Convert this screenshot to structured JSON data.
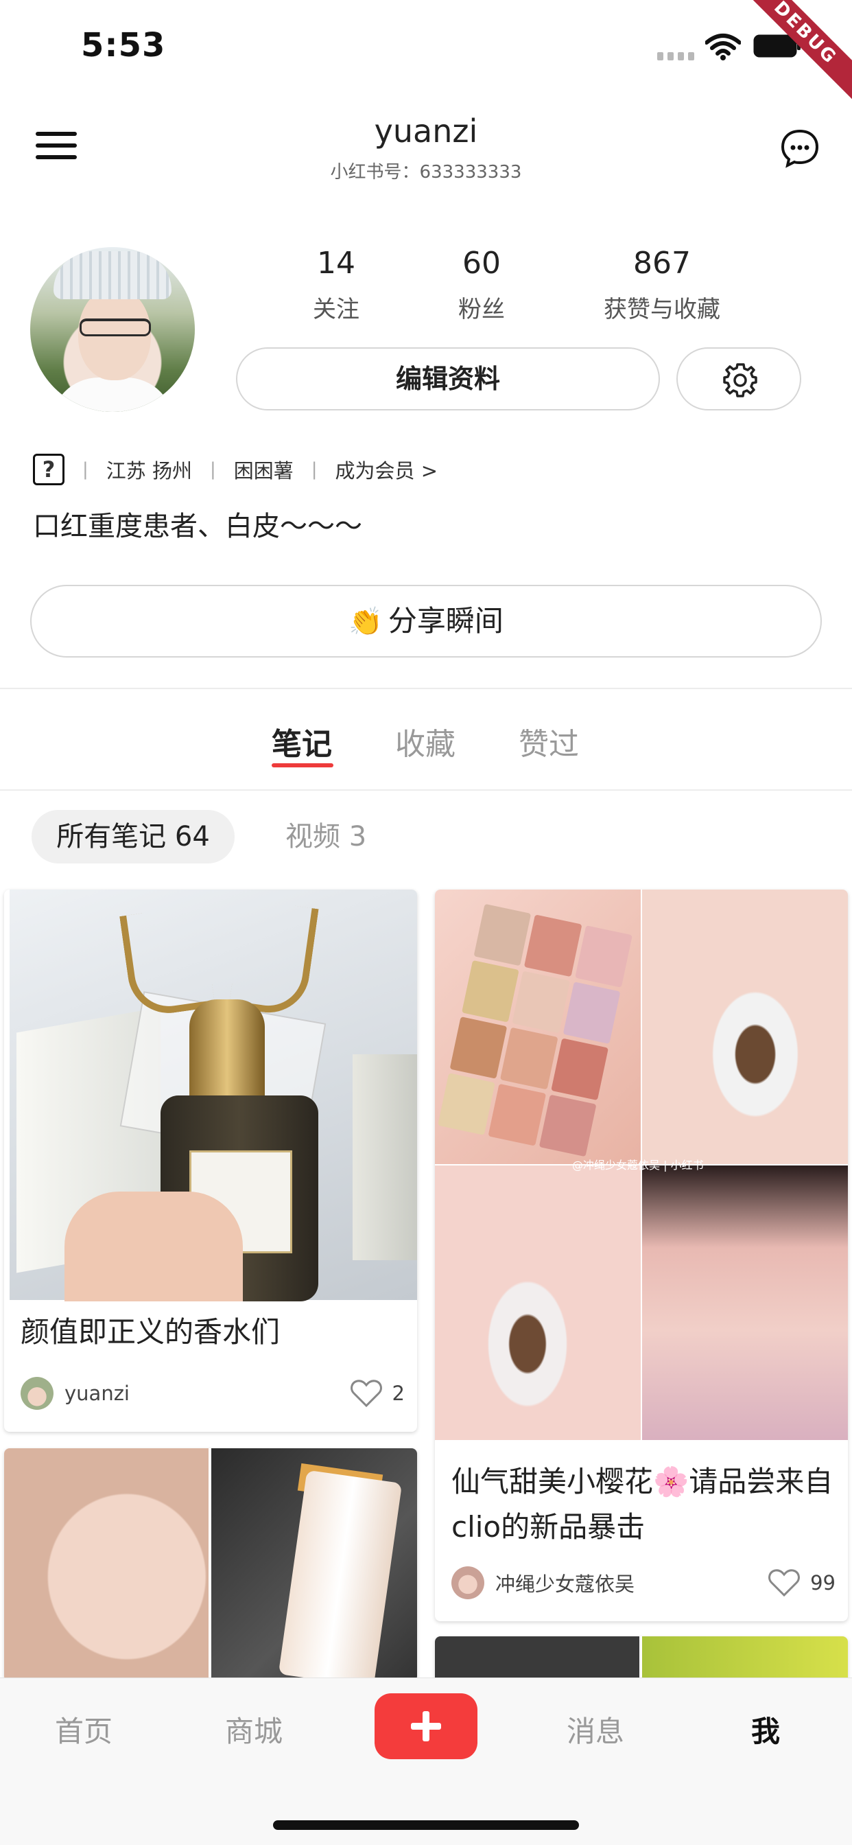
{
  "status_bar": {
    "time": "5:53",
    "debug_label": "DEBUG",
    "icons": [
      "signal-icon",
      "wifi-icon",
      "battery-icon"
    ]
  },
  "header": {
    "username": "yuanzi",
    "user_id": "小红书号：633333333",
    "left_icon": "menu-icon",
    "right_icon": "chat-icon"
  },
  "profile": {
    "stats": [
      {
        "value": "14",
        "label": "关注"
      },
      {
        "value": "60",
        "label": "粉丝"
      },
      {
        "value": "867",
        "label": "获赞与收藏"
      }
    ],
    "edit_button": "编辑资料",
    "settings_icon": "gear-icon",
    "gender_icon_text": "?",
    "location": "江苏 扬州",
    "tag": "困困薯",
    "member_link": "成为会员 >",
    "bio": "口红重度患者、白皮～～～",
    "share_emoji": "👏",
    "share_button": "分享瞬间"
  },
  "tabs": [
    {
      "label": "笔记",
      "active": true
    },
    {
      "label": "收藏",
      "active": false
    },
    {
      "label": "赞过",
      "active": false
    }
  ],
  "filters": [
    {
      "label": "所有笔记 64",
      "active": true
    },
    {
      "label": "视频 3",
      "active": false
    }
  ],
  "notes": [
    {
      "title": "颜值即正义的香水们",
      "author": "yuanzi",
      "likes": "2"
    },
    {
      "title": "仙气甜美小樱花🌸请品尝来自clio的新品暴击",
      "author": "冲绳少女蔻依吴",
      "likes": "99",
      "image_caption": "@冲绳少女蔻依吴 | 小红书"
    }
  ],
  "bottom_nav": [
    {
      "label": "首页",
      "active": false
    },
    {
      "label": "商城",
      "active": false
    },
    {
      "label": "消息",
      "active": false
    },
    {
      "label": "我",
      "active": true
    }
  ],
  "colors": {
    "accent": "#f43c3c",
    "tab_underline": "#ee3b3b",
    "inactive_text": "#999999"
  }
}
